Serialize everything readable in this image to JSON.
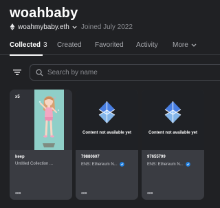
{
  "profile": {
    "username": "woahbaby",
    "ens_name": "woahmybaby.eth",
    "joined": "Joined July 2022"
  },
  "tabs": [
    {
      "label": "Collected",
      "count": "3"
    },
    {
      "label": "Created"
    },
    {
      "label": "Favorited"
    },
    {
      "label": "Activity"
    },
    {
      "label": "More"
    }
  ],
  "search": {
    "placeholder": "Search by name"
  },
  "cards": [
    {
      "quantity": "x5",
      "title": "keep",
      "collection": "Untitled Collection ...",
      "menu": "•••"
    },
    {
      "media_text": "Content not available yet",
      "title": "79880607",
      "collection": "ENS: Ethereum N...",
      "menu": "•••"
    },
    {
      "media_text": "Content not available yet",
      "title": "97655799",
      "collection": "ENS: Ethereum N...",
      "menu": "•••"
    }
  ],
  "colors": {
    "background": "#202124",
    "card": "#303238",
    "ens_logo": "#4d88f7",
    "verified": "#2081e2"
  },
  "icons": [
    "ethereum-icon",
    "chevron-down-icon",
    "filter-icon",
    "search-icon",
    "ens-logo-icon",
    "verified-badge-icon"
  ]
}
